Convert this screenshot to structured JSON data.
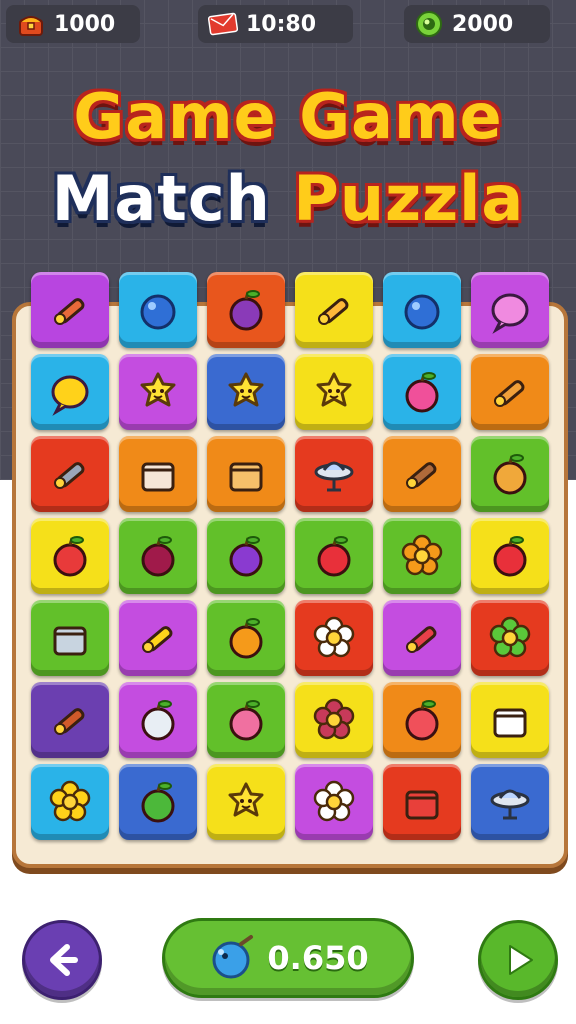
{
  "hud": {
    "coins": {
      "value": "1000",
      "icon": "treasure-chest-icon"
    },
    "timer": {
      "value": "10:80",
      "icon": "envelope-icon"
    },
    "gems": {
      "value": "2000",
      "icon": "green-gem-icon"
    }
  },
  "title": {
    "line1": "Game Game",
    "line2_word1": "Match",
    "line2_word2": "Puzzla"
  },
  "board": {
    "tiles": [
      {
        "color": "#b845e0",
        "icon": "pencil-icon"
      },
      {
        "color": "#2ab3e8",
        "icon": "blue-ball-icon"
      },
      {
        "color": "#e8561d",
        "icon": "purple-berry-icon"
      },
      {
        "color": "#f5e01a",
        "icon": "ice-cream-cone-icon"
      },
      {
        "color": "#2ab3e8",
        "icon": "green-ring-icon"
      },
      {
        "color": "#c44de0",
        "icon": "pink-bubble-icon"
      },
      {
        "color": "#2ab3e8",
        "icon": "yellow-bubble-icon"
      },
      {
        "color": "#c44de0",
        "icon": "star-face-icon"
      },
      {
        "color": "#3a6ad0",
        "icon": "frog-face-icon"
      },
      {
        "color": "#f5e01a",
        "icon": "sun-face-icon"
      },
      {
        "color": "#2ab3e8",
        "icon": "pink-apple-icon"
      },
      {
        "color": "#f08a18",
        "icon": "chili-pepper-icon"
      },
      {
        "color": "#e53a1f",
        "icon": "disc-tool-icon"
      },
      {
        "color": "#f08a18",
        "icon": "dice-cups-icon"
      },
      {
        "color": "#f08a18",
        "icon": "house-icon"
      },
      {
        "color": "#e53a1f",
        "icon": "ufo-icon"
      },
      {
        "color": "#f08a18",
        "icon": "pizza-cutter-icon"
      },
      {
        "color": "#62c02a",
        "icon": "bell-pepper-icon"
      },
      {
        "color": "#f5e01a",
        "icon": "red-apple-icon"
      },
      {
        "color": "#62c02a",
        "icon": "beet-icon"
      },
      {
        "color": "#62c02a",
        "icon": "plum-icon"
      },
      {
        "color": "#62c02a",
        "icon": "cherry-icon"
      },
      {
        "color": "#62c02a",
        "icon": "orange-flower-icon"
      },
      {
        "color": "#f5e01a",
        "icon": "map-pin-icon"
      },
      {
        "color": "#62c02a",
        "icon": "trash-can-icon"
      },
      {
        "color": "#c44de0",
        "icon": "banana-icon"
      },
      {
        "color": "#62c02a",
        "icon": "orange-fruit-icon"
      },
      {
        "color": "#e53a1f",
        "icon": "white-flower-icon"
      },
      {
        "color": "#c44de0",
        "icon": "lipstick-icon"
      },
      {
        "color": "#e53a1f",
        "icon": "green-flower-icon"
      },
      {
        "color": "#6b3fb0",
        "icon": "log-icon"
      },
      {
        "color": "#c44de0",
        "icon": "garlic-icon"
      },
      {
        "color": "#62c02a",
        "icon": "peach-icon"
      },
      {
        "color": "#f5e01a",
        "icon": "berry-branch-icon"
      },
      {
        "color": "#f08a18",
        "icon": "tomato-face-icon"
      },
      {
        "color": "#f5e01a",
        "icon": "picture-card-icon"
      },
      {
        "color": "#2ab3e8",
        "icon": "yellow-flower-icon"
      },
      {
        "color": "#3a6ad0",
        "icon": "cactus-icon"
      },
      {
        "color": "#f5e01a",
        "icon": "smiley-star-icon"
      },
      {
        "color": "#c44de0",
        "icon": "daisy-face-icon"
      },
      {
        "color": "#e53a1f",
        "icon": "spray-can-icon"
      },
      {
        "color": "#3a6ad0",
        "icon": "spinning-top-icon"
      }
    ]
  },
  "footer": {
    "back_icon": "arrow-left-icon",
    "balance": "0.650",
    "balance_icon": "blue-orb-icon",
    "play_icon": "play-triangle-icon"
  }
}
